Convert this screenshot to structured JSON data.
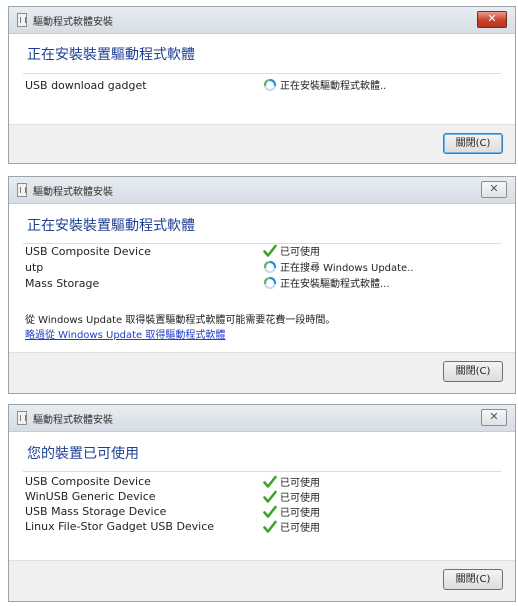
{
  "dialog1": {
    "title": "驅動程式軟體安裝",
    "heading": "正在安裝裝置驅動程式軟體",
    "devices": [
      {
        "name": "USB download gadget",
        "status": "正在安裝驅動程式軟體..",
        "icon": "spinner-icon"
      }
    ],
    "close_button": "關閉(C)"
  },
  "dialog2": {
    "title": "驅動程式軟體安裝",
    "heading": "正在安裝裝置驅動程式軟體",
    "devices": [
      {
        "name": "USB Composite Device",
        "status": "已可使用",
        "icon": "checkmark-icon"
      },
      {
        "name": "utp",
        "status": "正在搜尋 Windows Update..",
        "icon": "spinner-icon"
      },
      {
        "name": "Mass Storage",
        "status": "正在安裝驅動程式軟體...",
        "icon": "spinner-icon"
      }
    ],
    "note": "從 Windows Update 取得裝置驅動程式軟體可能需要花費一段時間。",
    "skip_link": "略過從 Windows Update 取得驅動程式軟體",
    "close_button": "關閉(C)"
  },
  "dialog3": {
    "title": "驅動程式軟體安裝",
    "heading": "您的裝置已可使用",
    "devices": [
      {
        "name": "USB Composite Device",
        "status": "已可使用",
        "icon": "checkmark-icon"
      },
      {
        "name": "WinUSB Generic Device",
        "status": "已可使用",
        "icon": "checkmark-icon"
      },
      {
        "name": "USB Mass Storage Device",
        "status": "已可使用",
        "icon": "checkmark-icon"
      },
      {
        "name": "Linux File-Stor Gadget USB Device",
        "status": "已可使用",
        "icon": "checkmark-icon"
      }
    ],
    "close_button": "關閉(C)"
  },
  "colors": {
    "heading": "#1e3f95",
    "link": "#1f3ec8",
    "check": "#3fa32a",
    "spinner": "#2c8fd6",
    "close_red": "#c9432c"
  }
}
